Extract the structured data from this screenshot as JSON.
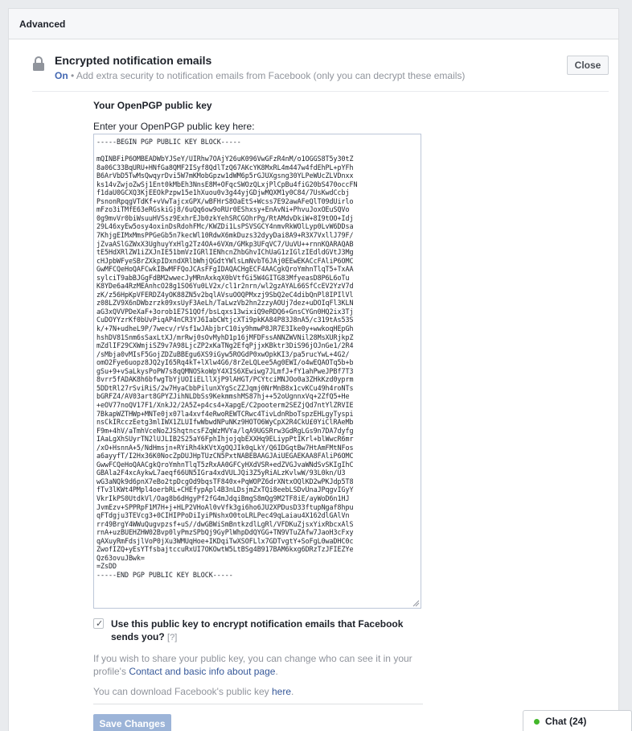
{
  "panel": {
    "header": "Advanced"
  },
  "setting": {
    "title": "Encrypted notification emails",
    "status": "On",
    "description": " • Add extra security to notification emails from Facebook (only you can decrypt these emails)",
    "close_label": "Close",
    "icon": "lock-icon"
  },
  "key_section": {
    "title": "Your OpenPGP public key",
    "input_label": "Enter your OpenPGP public key here:",
    "key_value": "-----BEGIN PGP PUBLIC KEY BLOCK-----\n\nmQINBFiP6OMBEADWbYJSeY/UIRhw7OAjY26uK096VwGFzR4nM/o1OGGS8T5y30tZ\n8a06C33BqURU+HNfGa8QMF2ISyf8QdlTzQ67AKcYK8MxRL4m447w4fdEhPL+pYFh\nB6ArVbD5TwMsQwqyrDvi5W7mKMobGpzw1dWM6p5rGJUXgsng30YLPeWUcZLVDnxx\nks14vZwjoZwSj1Ent0kMbEh3NnsE8M+OFqcSWOzQLxjPlCpBu4fiG20bS470occFN\nf1daU0GCXQ3KjEEOkPzpw15e1hXuou0v3g44yjGDjwMQXM1y0C84/7UsKwdCcbj\nPsnonRpqgVTdKf+vVwTajcxGPX/wBFHrS8OaEtS+Wcss7E92awAFeQlT09dUirlo\nmFzo3iTMfE63eRGskiGj8/6uQq6ow9oRUr0EShxsy+EnAvNi+PhvuJoxOEuSQVo\n0g9mvVr0biWsuuHVSsz9ExhrEJb0zkYehSRCGOhrPg/RtAMdvDkiW+8I9tOO+Idj\n29L46xyEw5osy4oxinDsRdohFMc/KWZDi1LsPSVSGCY4nmvRkWOlLyp0LvW6DDsa\n7KhjgEIMxMmsPPGeGb5n7kecWl10RdwX6mkDuzs32dyyDai8A9+R3X7VxllJ79F/\njZvaASlGZWxX3UghuyYxHlg2Tz4OA+6VXm/GMkp3UFqVC7/UuVU++rnnKQARAQAB\ntE5HdXRlZW1iZXJnIE51bmVzIGRlIENhcnZhbGhvIChUaG1zIGlzIEdldGVtJ3Mg\ncHJpbWFyeSBrZXkpIDxndXRlbWhjQGdtYWlsLmNvbT6JAj0EEwEKACcFAliP6OMC\nGwMFCQeHoQAFCwkIBwMFFQoJCAsFFgIDAQACHgECF4AACgkQroYmhnTlqT5+TxAA\nsylciT9abBJGgFdBM2wwecJyMRnAxkqX0bVtfGi5W4GITG83MfyeasD8P6L6oTu\nK8YDe6a4RzMEAnhcO28g1SO6Yu0LV2x/cl1r2nrn/wl2gzAYAL66SfCcEV2YzV7d\nzK/z56HpKpVFERDZ4yOK88ZN5v2bqlAVsuOOQPMxzj9SbQ2eC4dibQnPl8IPIlVl\nz08LZV9X6nDWbzrzk09xsUyF3AeLh/TaLwzVb2hn2zzyAOUj7dez+uDOIqFl3KLN\naG3xQVVPDeXaF+3orob1E7S1QOf/bsLqxs13wixiQ9eRDQ6+GnsCYGn0HQ2ix3Tj\nCuDOYYzrKf0bUvPiqAP4nCR3YJ6IabCWtjcXTi9pkKA84P83J8nA5/c319tAs53S\nk/+7N+udheL9P/7wecv/rVsf1wJAbjbrC10iy9hmwP8JR7E3Ike0y+wwkoqHEpGh\nhshDV81Snm6sSaxLtXJ/mrRwj0sOvMyhD1p16jMFDFssANNZWVNil28MsXURjkpZ\nmZdlIF29CXWmjiSZ9v7A98LjcZP2xKaTNg2EfqPjjxKBktr3DiS96jOJnGe1/2R4\n/sMbja0vMIsF5GojZDZuBBEgu6XS9iGyw5ROGdP0xwOpkKI3/pa5rucYwL+4G2/\nomO2Fye6uopz8JQ2yI65Rq4kT+lXlw4G6/8rZeLQLee5Ag0EWI/o4wEQAOTq5b+b\ngSu+9+vSaLkysPoPW7s8qQMNOSkoWpY4XIS6XEwiwg7JLmfJ+fY1ahPweJPBf7T3\n8vrr5fADAK8h6bfwgTbYjUOIiELllXjP9lAHGT/PCYtciMNJOo0a3ZHkKzd0yprm\n5DDtRl27rSviRiS/2w7HyaCbbPilunXYgScZZJqmj0NrMnB8x1cvKCu49h4roNTs\nbGRFZ4/AV03art8GPYZJihNLDbSs9KekmmshMS87hj++52oUgnnxVq+2ZfQ5+He\n+eOV77noQV17F1/XnkJ2/2A5Z+p4cs4+XapgE/C2pooterm2SEZjQd7ntYlZRVIE\n7BkapWZTHWp+MNTe0jx07la4xvf4eRwoREWTCRwc4TivLdnRboTspzEHLgyTyspi\nnsCkIRcczEetg3mlIWX1ZLUIfwWbwdNPuNKz9HOTO6WyCpX2R4CkU£0YiClRAeMb\nF9m+4hV/aTmhVceNoZJShqtncsFZqWzMVYa/lqA9UGSRrw3GdRgLGs9n7DA7dyfg\nIAaLgXhSUyrTN2lUJLIB2S25aY6FphIhjojqbEXXHq9ELiypPtIKrl+blWwcR6mr\n/xO+HsnnA+5/NdHmsjn+RYiRh4kKVtXgOQJIk0qLkY/Q6IDGqtBw7HtAmFMtNFos\na6ayyfT/I2Hx36K0NocZpDUJHpTUzCN5PxtNABEBAAGJAiUEGAEKAA8FAliP6OMC\nGwwFCQeHoQAACgkQroYmhnTlqT5zRxAA0GFCyHXdVSR+edZVGJvaWNdSvSKIgIhC\nGBAla2F4xcAykwL7aeqf66UN5IGra4xdVULJQi3Z5yRiALzKvlwW/93L0kn/U3\nwG3aNQk9d6pnX7eBo2tpDcgOd9bqsTF840x+PqWOPZ6drXNtxOQlKD2wPKJdp5T8\nfTv3lKWt4PMpl4oerbRL+CHEfypApl4B3nLDsjmZxTQi8eebLSDvUnaJPqgvIGyY\nVkrIkPS0UtdkVl/Oag8b6dHgyPf2fG4mJdqiBmgS8mQg9M2TF8iE/ayWoD6n1HJ\nJvmEzv+SPPRpF1M7H+j+HLP2VHoAl0vVfk3gi6ho6JU2XPDusD33ftupNgaf8hpu\nqFTdgju3TEVcg3+0CIHIPPoDiIyiPNshxO0toLRLPec49qLaiau4X162dlGAlVn\nrr49BrgY4WWuQugvpzsf+uS//dwGBWiSmBntkzdlLgRl/VFDKuZjsxYixRbcxAlS\nrnA+uzBUEHZHW02Bvp0lyPmzSPbQj9GyPlWhpDdQYGG+TN9VTuZAfw7JaoH3cFxy\nqAXuyRmFdsjlVoP0jXu3WMUqHoe+IKDqiTwXSOFLlx7GDTvgtY+SoFgL0waDHC0c\nZwofIZQ+yEsYTfsbajtccuRxUI7OKOwtW5LtBSg4B917BAM6kxg6DRzTzJFIEZYe\nQz63ovuJBwk=\n=ZsDD\n-----END PGP PUBLIC KEY BLOCK-----",
    "checkbox_label": "Use this public key to encrypt notification emails that Facebook sends you?",
    "help_marker": "[?]",
    "checkbox_checked": true,
    "share_note_prefix": "If you wish to share your public key, you can change who can see it in your profile's ",
    "share_note_link": "Contact and basic info about page",
    "share_note_suffix": ".",
    "download_note_prefix": "You can download Facebook's public key ",
    "download_note_link": "here",
    "download_note_suffix": ".",
    "save_label": "Save Changes"
  },
  "chat": {
    "label": "Chat (24)",
    "status_color": "#42b72a"
  },
  "colors": {
    "link": "#365899",
    "accent": "#4267b2",
    "save_disabled": "#9cb4d8"
  }
}
